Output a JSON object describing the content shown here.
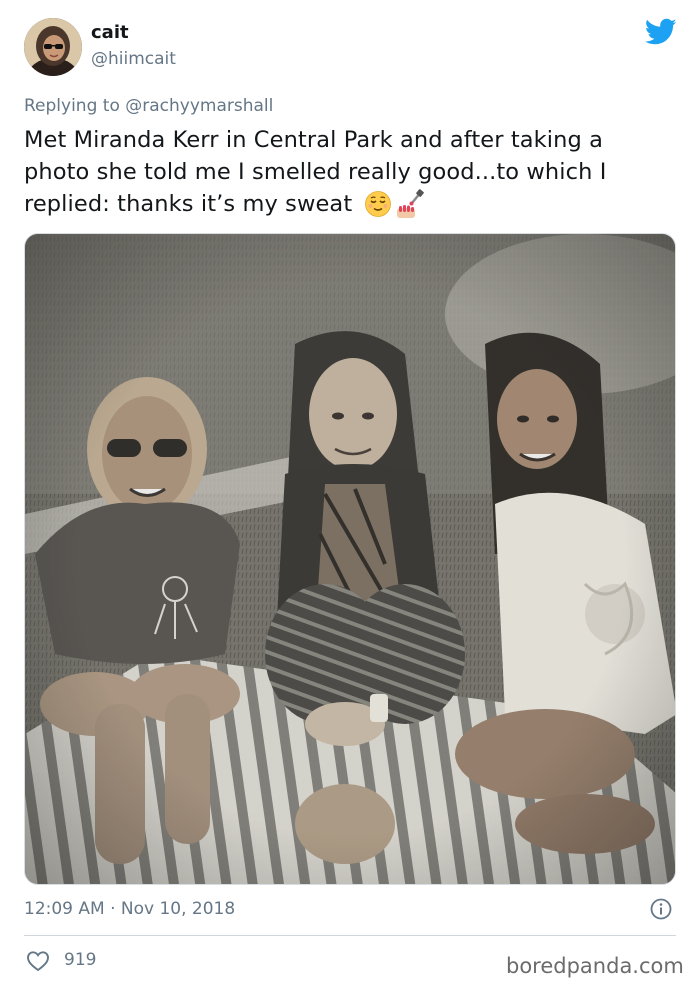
{
  "tweet": {
    "author_name": "cait",
    "author_handle": "@hiimcait",
    "reply_prefix": "Replying to ",
    "reply_to": "@rachyymarshall",
    "text_line1": "Met Miranda Kerr in Central Park and after taking a",
    "text_line2": "photo she told me I smelled really good...to which I",
    "text_line3": "replied: thanks it’s my sweat ",
    "emojis": [
      "relieved-face-emoji",
      "nail-polish-emoji"
    ],
    "photo_icon": "three-women-picnic-photo",
    "timestamp": "12:09 AM · Nov 10, 2018",
    "likes": "919"
  },
  "icons": {
    "brand": "twitter-bird-icon",
    "info": "info-icon",
    "like": "heart-icon"
  },
  "colors": {
    "brand_blue": "#1DA1F2",
    "secondary_text": "#657786",
    "primary_text": "#14171A"
  },
  "watermark": "boredpanda.com"
}
